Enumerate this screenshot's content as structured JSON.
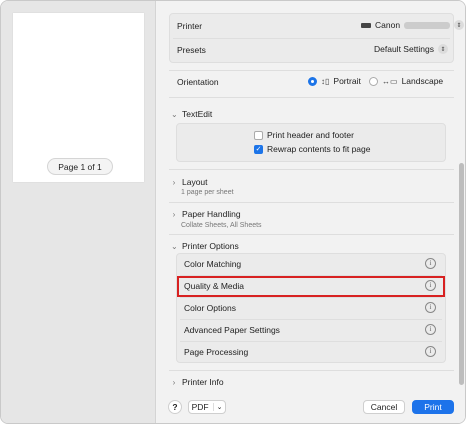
{
  "preview": {
    "page_indicator": "Page 1 of 1"
  },
  "printer": {
    "label": "Printer",
    "value": "Canon"
  },
  "presets": {
    "label": "Presets",
    "value": "Default Settings"
  },
  "orientation": {
    "label": "Orientation",
    "portrait": "Portrait",
    "landscape": "Landscape",
    "selected": "Portrait"
  },
  "textedit": {
    "title": "TextEdit",
    "options": [
      {
        "label": "Print header and footer",
        "checked": false
      },
      {
        "label": "Rewrap contents to fit page",
        "checked": true
      }
    ]
  },
  "sections": {
    "layout": {
      "title": "Layout",
      "subtitle": "1 page per sheet"
    },
    "paper_handling": {
      "title": "Paper Handling",
      "subtitle": "Collate Sheets, All Sheets"
    },
    "printer_options": {
      "title": "Printer Options"
    },
    "printer_info": {
      "title": "Printer Info"
    }
  },
  "printer_options_items": [
    "Color Matching",
    "Quality & Media",
    "Color Options",
    "Advanced Paper Settings",
    "Page Processing"
  ],
  "highlighted_item": "Quality & Media",
  "footer": {
    "help": "?",
    "pdf": "PDF",
    "cancel": "Cancel",
    "print": "Print"
  },
  "colors": {
    "accent": "#1d73ea",
    "highlight": "#d82121"
  }
}
